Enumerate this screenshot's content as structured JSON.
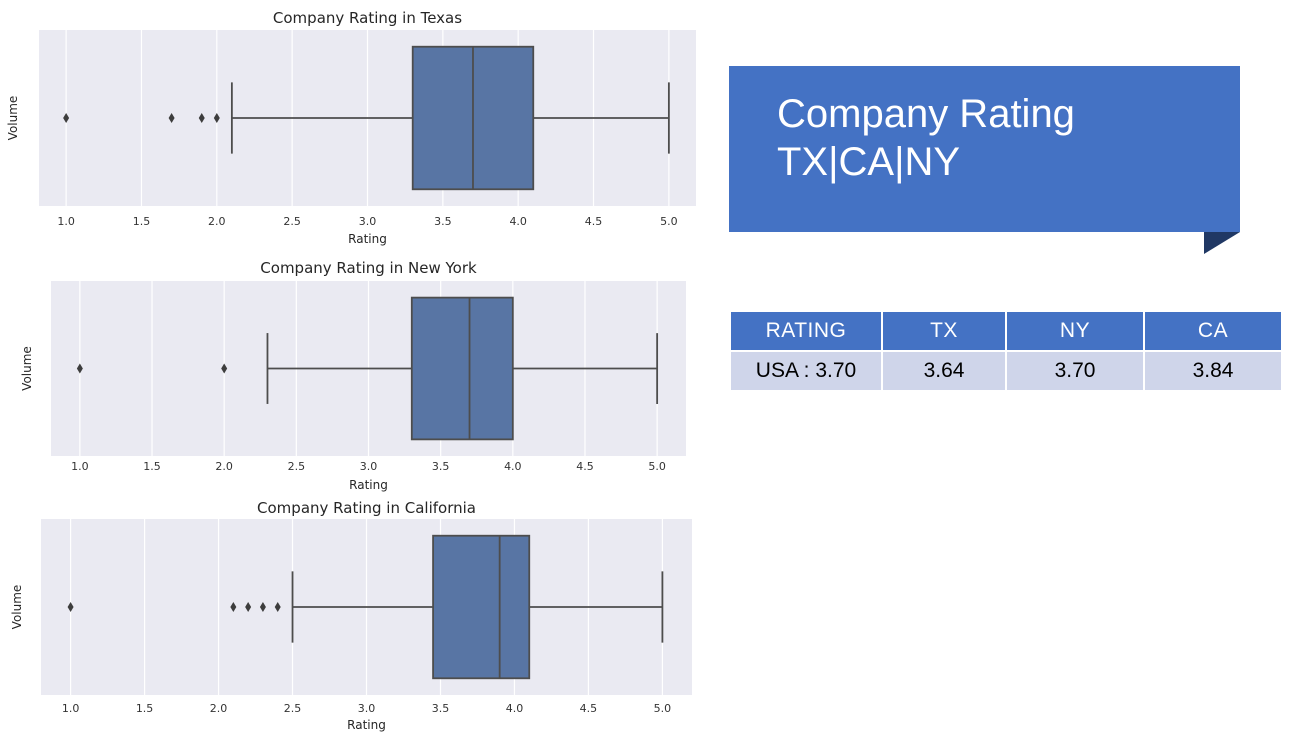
{
  "slide": {
    "title_line1": "Company Rating",
    "title_line2": "TX|CA|NY",
    "accent_color": "#4472c4",
    "fold_color": "#203864"
  },
  "table": {
    "headers": [
      "RATING",
      "TX",
      "NY",
      "CA"
    ],
    "row": [
      "USA : 3.70",
      "3.64",
      "3.70",
      "3.84"
    ],
    "header_color": "#4472c4",
    "row_color": "#cfd5ea"
  },
  "chart_data": [
    {
      "type": "box",
      "title": "Company Rating in Texas",
      "xlabel": "Rating",
      "ylabel": "Volume",
      "xlim": [
        0.82,
        5.18
      ],
      "xticks": [
        1.0,
        1.5,
        2.0,
        2.5,
        3.0,
        3.5,
        4.0,
        4.5,
        5.0
      ],
      "xtick_labels": [
        "1.0",
        "1.5",
        "2.0",
        "2.5",
        "3.0",
        "3.5",
        "4.0",
        "4.5",
        "5.0"
      ],
      "box": {
        "whisker_low": 2.1,
        "q1": 3.3,
        "median": 3.7,
        "q3": 4.1,
        "whisker_high": 5.0
      },
      "outliers": [
        1.0,
        1.7,
        1.9,
        2.0
      ],
      "grid": true,
      "box_color": "#5875a4",
      "background": "#eaeaf2"
    },
    {
      "type": "box",
      "title": "Company Rating in New York",
      "xlabel": "Rating",
      "ylabel": "Volume",
      "xlim": [
        0.8,
        5.2
      ],
      "xticks": [
        1.0,
        1.5,
        2.0,
        2.5,
        3.0,
        3.5,
        4.0,
        4.5,
        5.0
      ],
      "xtick_labels": [
        "1.0",
        "1.5",
        "2.0",
        "2.5",
        "3.0",
        "3.5",
        "4.0",
        "4.5",
        "5.0"
      ],
      "box": {
        "whisker_low": 2.3,
        "q1": 3.3,
        "median": 3.7,
        "q3": 4.0,
        "whisker_high": 5.0
      },
      "outliers": [
        1.0,
        2.0
      ],
      "grid": true,
      "box_color": "#5875a4",
      "background": "#eaeaf2"
    },
    {
      "type": "box",
      "title": "Company Rating in California",
      "xlabel": "Rating",
      "ylabel": "Volume",
      "xlim": [
        0.8,
        5.2
      ],
      "xticks": [
        1.0,
        1.5,
        2.0,
        2.5,
        3.0,
        3.5,
        4.0,
        4.5,
        5.0
      ],
      "xtick_labels": [
        "1.0",
        "1.5",
        "2.0",
        "2.5",
        "3.0",
        "3.5",
        "4.0",
        "4.5",
        "5.0"
      ],
      "box": {
        "whisker_low": 2.5,
        "q1": 3.45,
        "median": 3.9,
        "q3": 4.1,
        "whisker_high": 5.0
      },
      "outliers": [
        1.0,
        2.1,
        2.2,
        2.3,
        2.4
      ],
      "grid": true,
      "box_color": "#5875a4",
      "background": "#eaeaf2"
    }
  ]
}
